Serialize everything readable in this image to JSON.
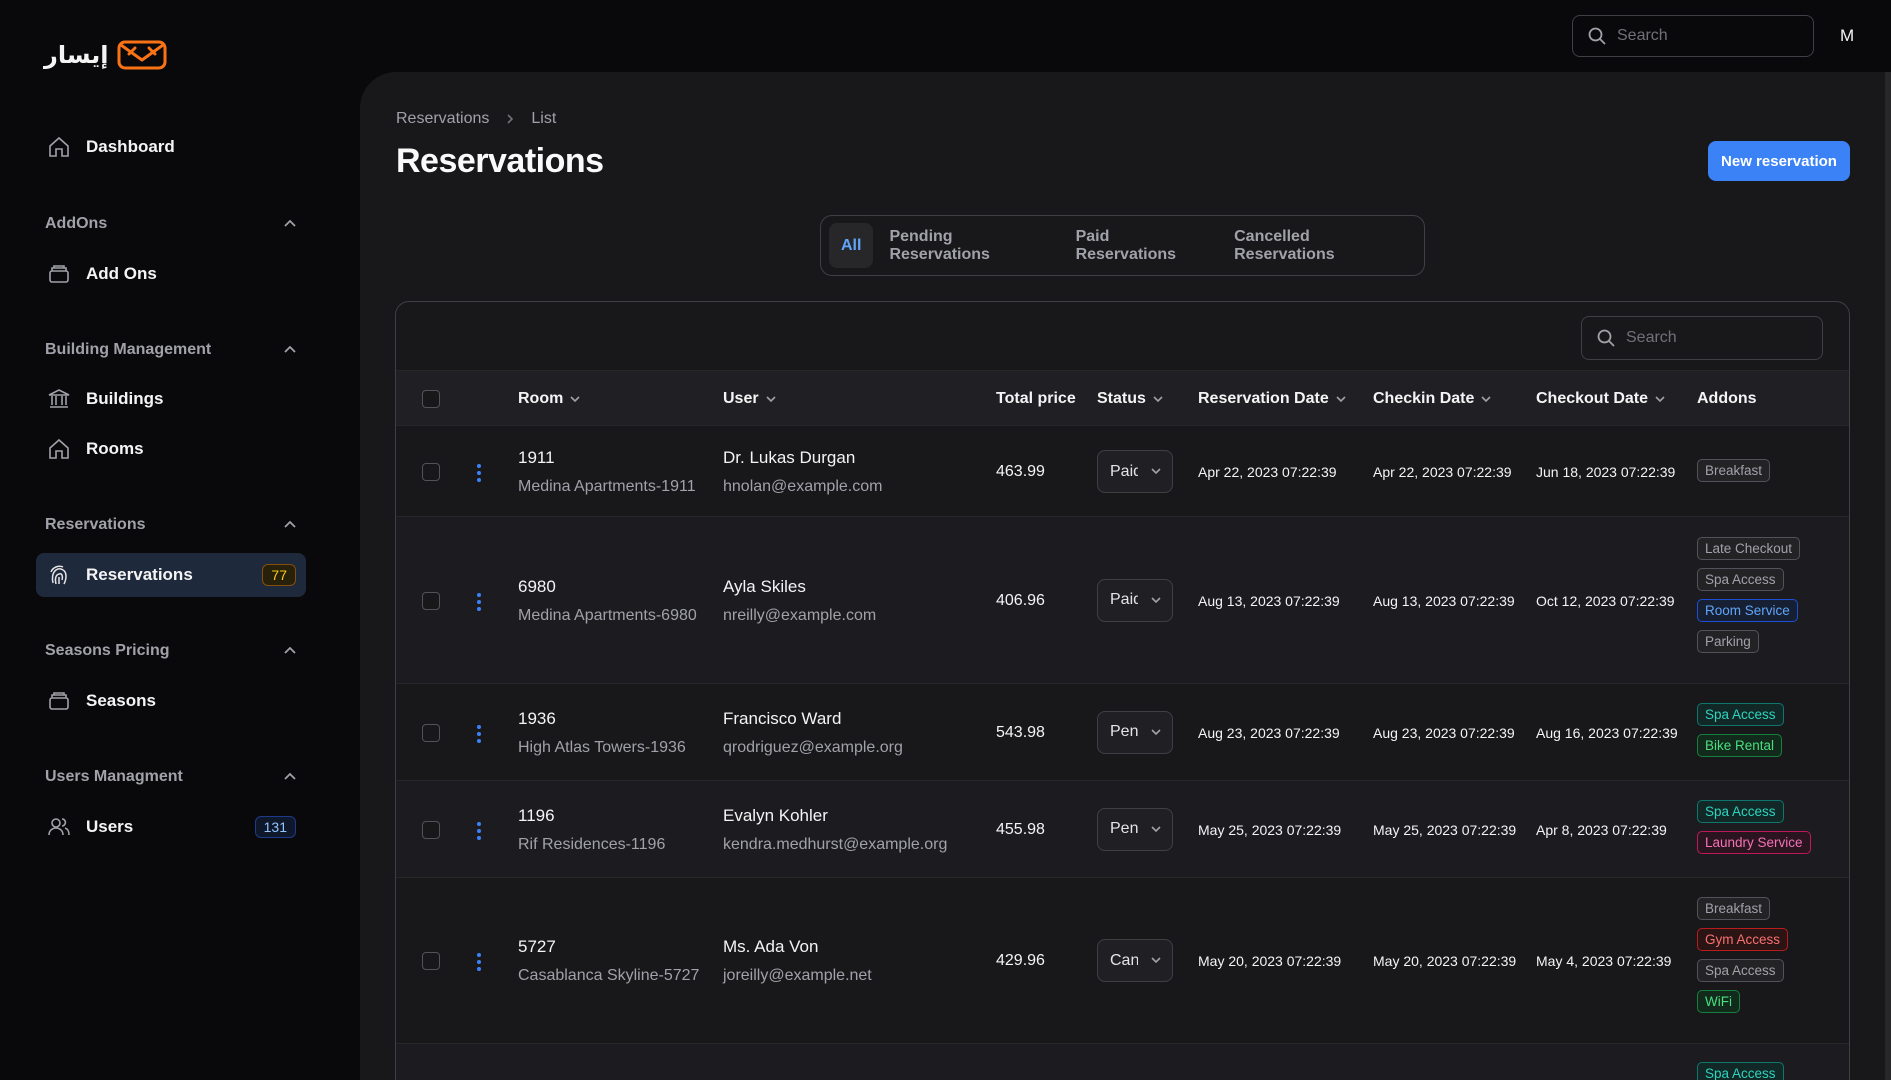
{
  "app": {
    "logo_text": "إيسار",
    "brand_color": "#f97316",
    "accent_color": "#3b82f6"
  },
  "topbar": {
    "search_placeholder": "Search",
    "avatar_initial": "M"
  },
  "sidebar": {
    "dashboard": "Dashboard",
    "groups": {
      "addons": {
        "label": "AddOns",
        "item": "Add Ons"
      },
      "building": {
        "label": "Building Management",
        "items": [
          "Buildings",
          "Rooms"
        ]
      },
      "reservations": {
        "label": "Reservations",
        "item": "Reservations",
        "badge": "77"
      },
      "seasons": {
        "label": "Seasons Pricing",
        "item": "Seasons"
      },
      "users": {
        "label": "Users Managment",
        "item": "Users",
        "badge": "131"
      }
    }
  },
  "page": {
    "breadcrumb": [
      "Reservations",
      "List"
    ],
    "title": "Reservations",
    "new_button": "New reservation",
    "tabs": [
      "All",
      "Pending Reservations",
      "Paid Reservations",
      "Cancelled Reservations"
    ],
    "active_tab": "All"
  },
  "table": {
    "search_placeholder": "Search",
    "columns": {
      "room": "Room",
      "user": "User",
      "total_price": "Total price",
      "status": "Status",
      "reservation_date": "Reservation Date",
      "checkin_date": "Checkin Date",
      "checkout_date": "Checkout Date",
      "addons": "Addons"
    },
    "rows": [
      {
        "room": "1911",
        "room_name": "Medina Apartments-1911",
        "user": "Dr. Lukas Durgan",
        "email": "hnolan@example.com",
        "price": "463.99",
        "status": "Paid",
        "reservation_date": "Apr 22, 2023 07:22:39",
        "checkin_date": "Apr 22, 2023 07:22:39",
        "checkout_date": "Jun 18, 2023 07:22:39",
        "addons": [
          {
            "label": "Breakfast",
            "color": "gray"
          }
        ]
      },
      {
        "room": "6980",
        "room_name": "Medina Apartments-6980",
        "user": "Ayla Skiles",
        "email": "nreilly@example.com",
        "price": "406.96",
        "status": "Paid",
        "reservation_date": "Aug 13, 2023 07:22:39",
        "checkin_date": "Aug 13, 2023 07:22:39",
        "checkout_date": "Oct 12, 2023 07:22:39",
        "addons": [
          {
            "label": "Late Checkout",
            "color": "gray"
          },
          {
            "label": "Spa Access",
            "color": "gray"
          },
          {
            "label": "Room Service",
            "color": "blue"
          },
          {
            "label": "Parking",
            "color": "gray"
          }
        ]
      },
      {
        "room": "1936",
        "room_name": "High Atlas Towers-1936",
        "user": "Francisco Ward",
        "email": "qrodriguez@example.org",
        "price": "543.98",
        "status": "Pending",
        "reservation_date": "Aug 23, 2023 07:22:39",
        "checkin_date": "Aug 23, 2023 07:22:39",
        "checkout_date": "Aug 16, 2023 07:22:39",
        "addons": [
          {
            "label": "Spa Access",
            "color": "teal"
          },
          {
            "label": "Bike Rental",
            "color": "green"
          }
        ]
      },
      {
        "room": "1196",
        "room_name": "Rif Residences-1196",
        "user": "Evalyn Kohler",
        "email": "kendra.medhurst@example.org",
        "price": "455.98",
        "status": "Pending",
        "reservation_date": "May 25, 2023 07:22:39",
        "checkin_date": "May 25, 2023 07:22:39",
        "checkout_date": "Apr 8, 2023 07:22:39",
        "addons": [
          {
            "label": "Spa Access",
            "color": "teal"
          },
          {
            "label": "Laundry Service",
            "color": "pink"
          }
        ]
      },
      {
        "room": "5727",
        "room_name": "Casablanca Skyline-5727",
        "user": "Ms. Ada Von",
        "email": "joreilly@example.net",
        "price": "429.96",
        "status": "Cancelled",
        "reservation_date": "May 20, 2023 07:22:39",
        "checkin_date": "May 20, 2023 07:22:39",
        "checkout_date": "May 4, 2023 07:22:39",
        "addons": [
          {
            "label": "Breakfast",
            "color": "gray"
          },
          {
            "label": "Gym Access",
            "color": "red"
          },
          {
            "label": "Spa Access",
            "color": "gray"
          },
          {
            "label": "WiFi",
            "color": "green"
          }
        ]
      },
      {
        "room": "",
        "room_name": "",
        "user": "",
        "email": "",
        "price": "",
        "status": "",
        "reservation_date": "",
        "checkin_date": "",
        "checkout_date": "",
        "addons": [
          {
            "label": "Spa Access",
            "color": "teal"
          }
        ]
      }
    ]
  }
}
